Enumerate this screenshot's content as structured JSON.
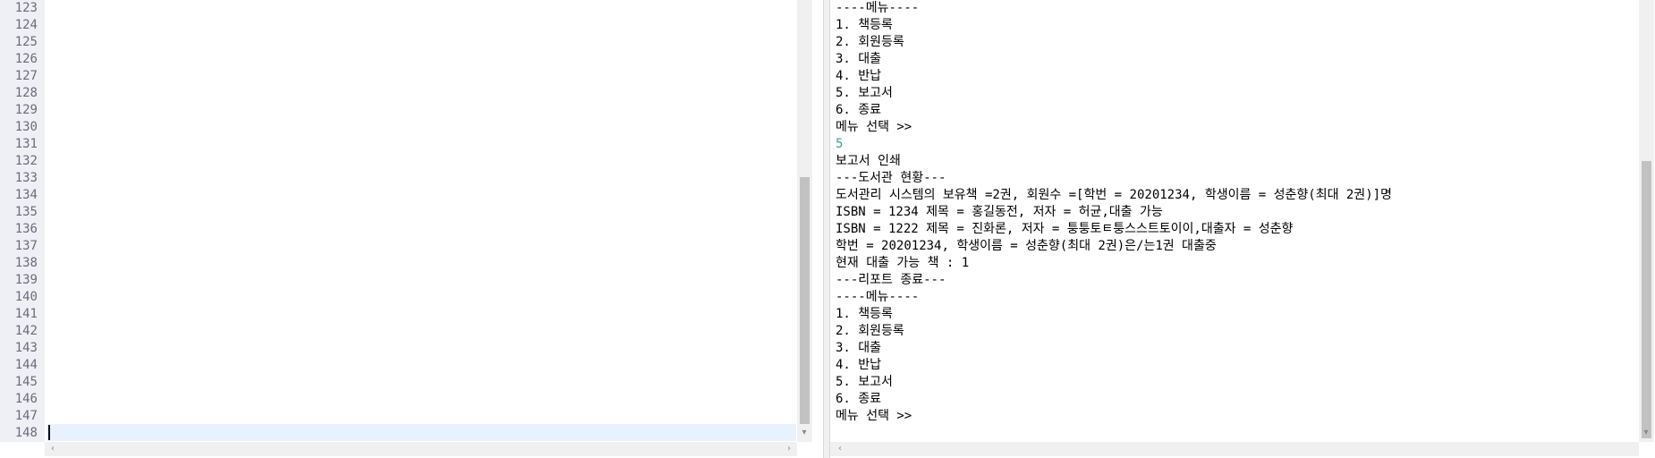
{
  "editor": {
    "line_numbers": [
      "123",
      "124",
      "125",
      "126",
      "127",
      "128",
      "129",
      "130",
      "131",
      "132",
      "133",
      "134",
      "135",
      "136",
      "137",
      "138",
      "139",
      "140",
      "141",
      "142",
      "143",
      "144",
      "145",
      "146",
      "147",
      "148"
    ],
    "current_line": "148"
  },
  "console": {
    "lines": [
      {
        "text": "----메뉴----",
        "type": "output"
      },
      {
        "text": "1. 책등록",
        "type": "output"
      },
      {
        "text": "2. 회원등록",
        "type": "output"
      },
      {
        "text": "3. 대출",
        "type": "output"
      },
      {
        "text": "4. 반납",
        "type": "output"
      },
      {
        "text": "5. 보고서",
        "type": "output"
      },
      {
        "text": "6. 종료",
        "type": "output"
      },
      {
        "text": "메뉴 선택 >>",
        "type": "output"
      },
      {
        "text": "5",
        "type": "input"
      },
      {
        "text": "보고서 인쇄",
        "type": "output"
      },
      {
        "text": "---도서관 현황---",
        "type": "output"
      },
      {
        "text": "도서관리 시스템의 보유책 =2권, 회원수 =[학번 = 20201234, 학생이름 = 성춘향(최대 2권)]명",
        "type": "output"
      },
      {
        "text": "ISBN = 1234 제목 = 홍길동전, 저자 = 허균,대출 가능",
        "type": "output"
      },
      {
        "text": "ISBN = 1222 제목 = 진화론, 저자 = 퉁퉁토ㅌ퉁스스트토이이,대출자 = 성춘향",
        "type": "output"
      },
      {
        "text": "학번 = 20201234, 학생이름 = 성춘향(최대 2권)은/는1권 대출중",
        "type": "output"
      },
      {
        "text": "현재 대출 가능 책 : 1",
        "type": "output"
      },
      {
        "text": "---리포트 종료---",
        "type": "output"
      },
      {
        "text": "----메뉴----",
        "type": "output"
      },
      {
        "text": "1. 책등록",
        "type": "output"
      },
      {
        "text": "2. 회원등록",
        "type": "output"
      },
      {
        "text": "3. 대출",
        "type": "output"
      },
      {
        "text": "4. 반납",
        "type": "output"
      },
      {
        "text": "5. 보고서",
        "type": "output"
      },
      {
        "text": "6. 종료",
        "type": "output"
      },
      {
        "text": "메뉴 선택 >>",
        "type": "output"
      }
    ]
  },
  "icons": {
    "scroll_up": "chevron-up-icon",
    "scroll_down": "chevron-down-icon",
    "scroll_left": "chevron-left-icon",
    "scroll_right": "chevron-right-icon"
  },
  "colors": {
    "gutter_bg": "#eef0f6",
    "current_line_bg": "#e8f2fe",
    "input_text": "#3a9f8f"
  }
}
